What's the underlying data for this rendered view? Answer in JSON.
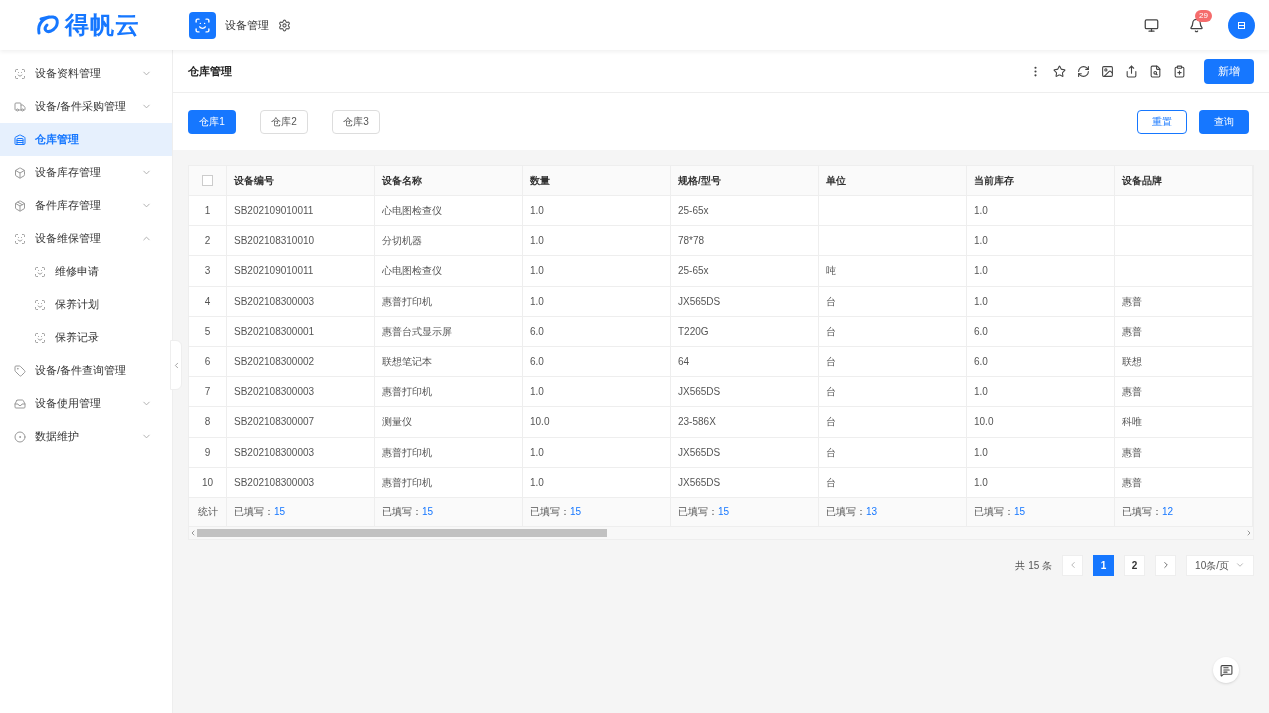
{
  "header": {
    "logo": "得帆云",
    "app_title": "设备管理",
    "notification_count": "29"
  },
  "sidebar": {
    "items": [
      {
        "label": "设备资料管理",
        "kind": "group",
        "selected": false,
        "expanded": false
      },
      {
        "label": "设备/备件采购管理",
        "kind": "group",
        "selected": false,
        "expanded": false
      },
      {
        "label": "仓库管理",
        "kind": "page",
        "selected": true
      },
      {
        "label": "设备库存管理",
        "kind": "group",
        "selected": false,
        "expanded": false
      },
      {
        "label": "备件库存管理",
        "kind": "group",
        "selected": false,
        "expanded": false
      },
      {
        "label": "设备维保管理",
        "kind": "group",
        "selected": false,
        "expanded": true,
        "children": [
          {
            "label": "维修申请",
            "selected": false
          },
          {
            "label": "保养计划",
            "selected": false
          },
          {
            "label": "保养记录",
            "selected": false
          }
        ]
      },
      {
        "label": "设备/备件查询管理",
        "kind": "page",
        "selected": false
      },
      {
        "label": "设备使用管理",
        "kind": "group",
        "selected": false,
        "expanded": false
      },
      {
        "label": "数据维护",
        "kind": "group",
        "selected": false,
        "expanded": false
      }
    ]
  },
  "page": {
    "title": "仓库管理",
    "add_button": "新增"
  },
  "filter": {
    "tabs": [
      {
        "label": "仓库1",
        "selected": true
      },
      {
        "label": "仓库2",
        "selected": false
      },
      {
        "label": "仓库3",
        "selected": false
      }
    ],
    "reset_button": "重置",
    "query_button": "查询"
  },
  "table": {
    "select_all_checked": false,
    "columns": [
      "设备编号",
      "设备名称",
      "数量",
      "规格/型号",
      "单位",
      "当前库存",
      "设备品牌"
    ],
    "rows": [
      {
        "index": "1",
        "cells": [
          "SB202109010011",
          "心电图检查仪",
          "1.0",
          "25-65x",
          "",
          "1.0",
          ""
        ]
      },
      {
        "index": "2",
        "cells": [
          "SB202108310010",
          "分切机器",
          "1.0",
          "78*78",
          "",
          "1.0",
          ""
        ]
      },
      {
        "index": "3",
        "cells": [
          "SB202109010011",
          "心电图检查仪",
          "1.0",
          "25-65x",
          "吨",
          "1.0",
          ""
        ]
      },
      {
        "index": "4",
        "cells": [
          "SB202108300003",
          "惠普打印机",
          "1.0",
          "JX565DS",
          "台",
          "1.0",
          "惠普"
        ]
      },
      {
        "index": "5",
        "cells": [
          "SB202108300001",
          "惠普台式显示屏",
          "6.0",
          "T220G",
          "台",
          "6.0",
          "惠普"
        ]
      },
      {
        "index": "6",
        "cells": [
          "SB202108300002",
          "联想笔记本",
          "6.0",
          "64",
          "台",
          "6.0",
          "联想"
        ]
      },
      {
        "index": "7",
        "cells": [
          "SB202108300003",
          "惠普打印机",
          "1.0",
          "JX565DS",
          "台",
          "1.0",
          "惠普"
        ]
      },
      {
        "index": "8",
        "cells": [
          "SB202108300007",
          "测量仪",
          "10.0",
          "23-586X",
          "台",
          "10.0",
          "科唯"
        ]
      },
      {
        "index": "9",
        "cells": [
          "SB202108300003",
          "惠普打印机",
          "1.0",
          "JX565DS",
          "台",
          "1.0",
          "惠普"
        ]
      },
      {
        "index": "10",
        "cells": [
          "SB202108300003",
          "惠普打印机",
          "1.0",
          "JX565DS",
          "台",
          "1.0",
          "惠普"
        ]
      }
    ],
    "summary": {
      "label": "统计",
      "cells": [
        {
          "label": "已填写：",
          "value": "15"
        },
        {
          "label": "已填写：",
          "value": "15"
        },
        {
          "label": "已填写：",
          "value": "15"
        },
        {
          "label": "已填写：",
          "value": "15"
        },
        {
          "label": "已填写：",
          "value": "13"
        },
        {
          "label": "已填写：",
          "value": "15"
        },
        {
          "label": "已填写：",
          "value": "12"
        }
      ]
    }
  },
  "pagination": {
    "total": "共 15 条",
    "pages": [
      {
        "label": "1",
        "selected": true
      },
      {
        "label": "2",
        "selected": false
      }
    ],
    "page_size": "10条/页"
  }
}
